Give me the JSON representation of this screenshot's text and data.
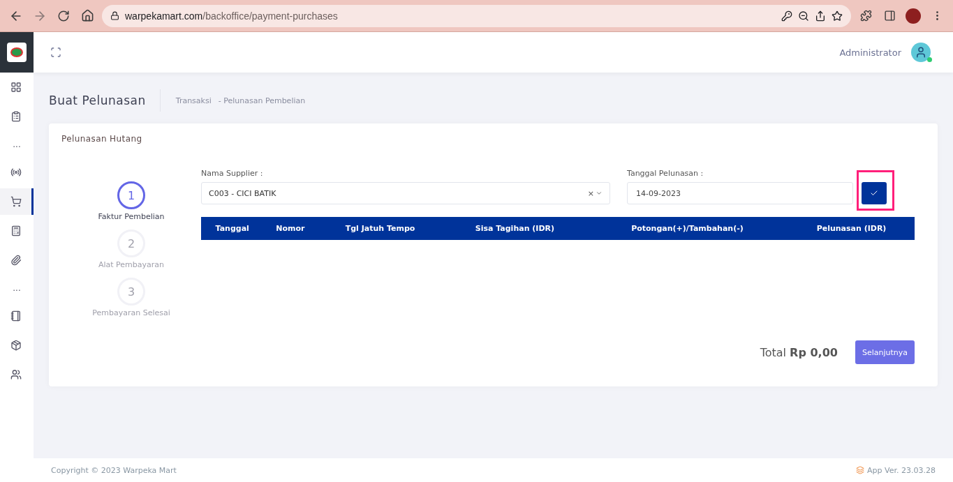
{
  "browser": {
    "url_host": "warpekamart.com",
    "url_path": "/backoffice/payment-purchases"
  },
  "sidebar": {
    "items": [
      {
        "kind": "icon",
        "selected": false
      },
      {
        "kind": "icon",
        "selected": false
      },
      {
        "kind": "separator",
        "label": "..."
      },
      {
        "kind": "icon",
        "selected": false
      },
      {
        "kind": "icon",
        "selected": true
      },
      {
        "kind": "icon",
        "selected": false
      },
      {
        "kind": "icon",
        "selected": false
      },
      {
        "kind": "separator",
        "label": "..."
      },
      {
        "kind": "icon",
        "selected": false
      },
      {
        "kind": "icon",
        "selected": false
      },
      {
        "kind": "icon",
        "selected": false
      }
    ]
  },
  "header": {
    "user": "Administrator",
    "online": true
  },
  "page": {
    "title": "Buat Pelunasan",
    "breadcrumb": [
      "Transaksi",
      "- Pelunasan Pembelian"
    ]
  },
  "card": {
    "title": "Pelunasan Hutang",
    "steps": [
      {
        "number": "1",
        "label": "Faktur Pembelian",
        "selected": true
      },
      {
        "number": "2",
        "label": "Alat Pembayaran",
        "selected": false
      },
      {
        "number": "3",
        "label": "Pembayaran Selesai",
        "selected": false
      }
    ],
    "supplier": {
      "label": "Nama Supplier :",
      "value": "C003 - CICI BATIK",
      "clear": "×"
    },
    "date": {
      "label": "Tanggal Pelunasan :",
      "value": "14-09-2023"
    },
    "table": {
      "columns": [
        "Tanggal",
        "Nomor",
        "Tgl Jatuh Tempo",
        "Sisa Tagihan (IDR)",
        "Potongan(+)/Tambahan(-)",
        "Pelunasan (IDR)"
      ]
    },
    "total": "Total **Rp 0,00**",
    "next_button": "Selanjutnya"
  },
  "footer": {
    "copyright": "Copyright © 2023 Warpeka Mart",
    "version": "App Ver. 23.03.28"
  }
}
